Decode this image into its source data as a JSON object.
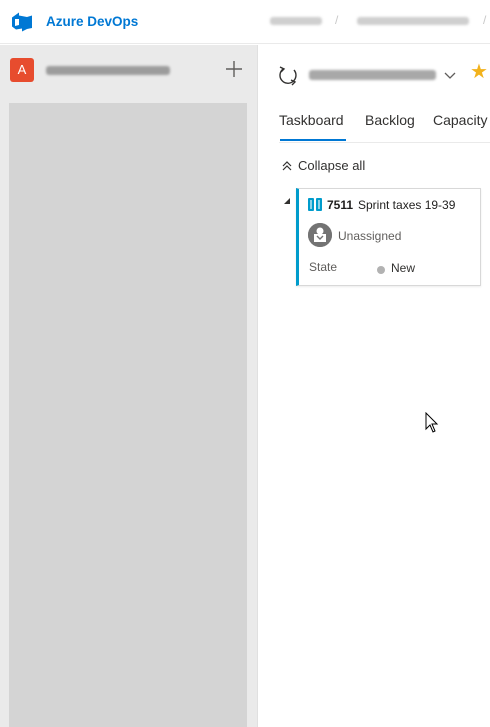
{
  "header": {
    "product_name": "Azure DevOps",
    "logo_icon": "azure-devops-logo-icon",
    "accent_color": "#0078d4"
  },
  "sidebar": {
    "project_avatar_letter": "A",
    "project_avatar_color": "#e74c2e",
    "add_icon": "plus-icon"
  },
  "main": {
    "star_icon": "star-icon",
    "tabs": [
      {
        "label": "Taskboard",
        "selected": true
      },
      {
        "label": "Backlog",
        "selected": false
      },
      {
        "label": "Capacity",
        "selected": false
      }
    ],
    "collapse_label": "Collapse all",
    "card": {
      "id": "7511",
      "title": "Sprint taxes 19-39",
      "assignee": "Unassigned",
      "state_label": "State",
      "state_value": "New",
      "accent_color": "#009ccc"
    }
  }
}
